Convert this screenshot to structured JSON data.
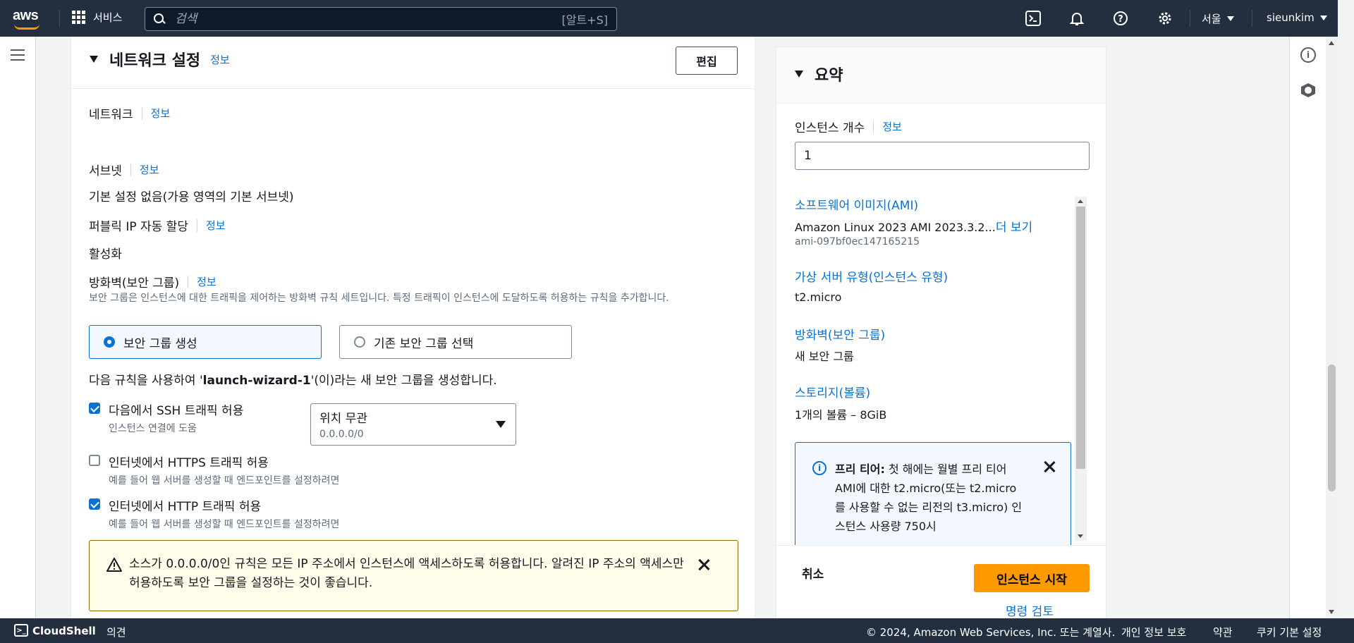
{
  "topnav": {
    "logo_text": "aws",
    "services_label": "서비스",
    "search_placeholder": "검색",
    "search_shortcut": "[알트+S]",
    "region": "서울",
    "user": "sieunkim"
  },
  "network": {
    "title": "네트워크 설정",
    "info": "정보",
    "edit": "편집",
    "network_label": "네트워크",
    "subnet_label": "서브넷",
    "subnet_value": "기본 설정 없음(가용 영역의 기본 서브넷)",
    "public_ip_label": "퍼블릭 IP 자동 할당",
    "public_ip_value": "활성화",
    "firewall_label": "방화벽(보안 그룹)",
    "firewall_desc": "보안 그룹은 인스턴스에 대한 트래픽을 제어하는 방화벽 규칙 세트입니다. 특정 트래픽이 인스턴스에 도달하도록 허용하는 규칙을 추가합니다.",
    "create_sg": "보안 그룹 생성",
    "select_sg": "기존 보안 그룹 선택",
    "sg_note_prefix": "다음 규칙을 사용하여 '",
    "sg_note_name": "launch-wizard-1",
    "sg_note_suffix": "'(이)라는 새 보안 그룹을 생성합니다.",
    "ssh_label": "다음에서 SSH 트래픽 허용",
    "ssh_sub": "인스턴스 연결에 도움",
    "ssh_source": "위치 무관",
    "ssh_cidr": "0.0.0.0/0",
    "https_label": "인터넷에서 HTTPS 트래픽 허용",
    "https_sub": "예를 들어 웹 서버를 생성할 때 엔드포인트를 설정하려면",
    "http_label": "인터넷에서 HTTP 트래픽 허용",
    "http_sub": "예를 들어 웹 서버를 생성할 때 엔드포인트를 설정하려면",
    "warning": "소스가 0.0.0.0/0인 규칙은 모든 IP 주소에서 인스턴스에 액세스하도록 허용합니다. 알려진 IP 주소의 액세스만 허용하도록 보안 그룹을 설정하는 것이 좋습니다."
  },
  "summary": {
    "title": "요약",
    "count_label": "인스턴스 개수",
    "info": "정보",
    "count_value": "1",
    "ami_label": "소프트웨어 이미지(AMI)",
    "ami_value": "Amazon Linux 2023 AMI 2023.3.2...",
    "ami_more": "더 보기",
    "ami_id": "ami-097bf0ec147165215",
    "type_label": "가상 서버 유형(인스턴스 유형)",
    "type_value": "t2.micro",
    "fw_label": "방화벽(보안 그룹)",
    "fw_value": "새 보안 그룹",
    "storage_label": "스토리지(볼륨)",
    "storage_value": "1개의 볼륨 – 8GiB",
    "free_tier_bold": "프리 티어:",
    "free_tier_text": " 첫 해에는 월별 프리 티어 AMI에 대한 t2.micro(또는 t2.micro를 사용할 수 없는 리전의 t3.micro) 인스턴스 사용량 750시",
    "cancel": "취소",
    "launch": "인스턴스 시작",
    "review": "명령 검토"
  },
  "footer": {
    "cloudshell": "CloudShell",
    "feedback": "의견",
    "copyright": "© 2024, Amazon Web Services, Inc. 또는 계열사.",
    "privacy": "개인 정보 보호",
    "terms": "약관",
    "cookies": "쿠키 기본 설정"
  }
}
